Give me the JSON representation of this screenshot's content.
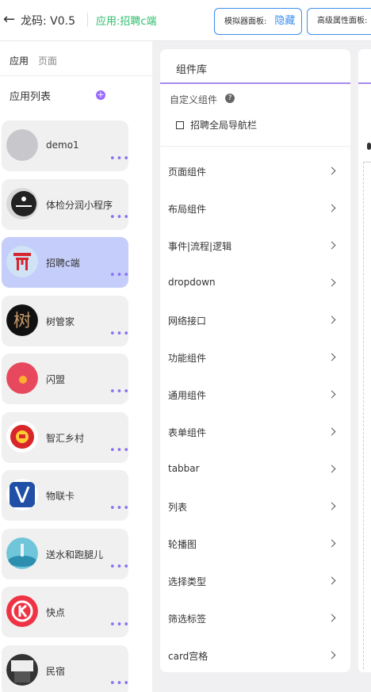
{
  "header": {
    "app_title": "龙码: V0.5",
    "current_app": "应用:招聘c端",
    "simulator_panel": {
      "label": "模拟器面板:",
      "action": "隐藏"
    },
    "advanced_panel": {
      "label": "高级属性面板:"
    }
  },
  "left_tabs": [
    "应用",
    "页面"
  ],
  "app_list_title": "应用列表",
  "add_icon": "plus-icon",
  "apps": [
    {
      "name": "demo1",
      "avatar": "grey-circle"
    },
    {
      "name": "体检分润小程序",
      "avatar": "dark-logo"
    },
    {
      "name": "招聘c端",
      "avatar": "red-torii",
      "selected": true
    },
    {
      "name": "树管家",
      "avatar": "tree-char"
    },
    {
      "name": "闪盟",
      "avatar": "pink-dot"
    },
    {
      "name": "智汇乡村",
      "avatar": "red-emblem"
    },
    {
      "name": "物联卡",
      "avatar": "blue-shield"
    },
    {
      "name": "送水和跑腿儿",
      "avatar": "teal-photo"
    },
    {
      "name": "快点",
      "avatar": "red-k"
    },
    {
      "name": "民宿",
      "avatar": "dark-photo"
    }
  ],
  "library": {
    "title": "组件库",
    "custom_title": "自定义组件",
    "custom_items": [
      "招聘全局导航栏"
    ],
    "categories": [
      "页面组件",
      "布局组件",
      "事件|流程|逻辑",
      "dropdown",
      "网络接口",
      "功能组件",
      "通用组件",
      "表单组件",
      "tabbar",
      "列表",
      "轮播图",
      "选择类型",
      "筛选标签",
      "card宫格"
    ]
  },
  "colors": {
    "accent": "#a78cf0",
    "selected": "#c5cdfa",
    "green": "#2bbd6c",
    "blue": "#3a8ef0"
  }
}
